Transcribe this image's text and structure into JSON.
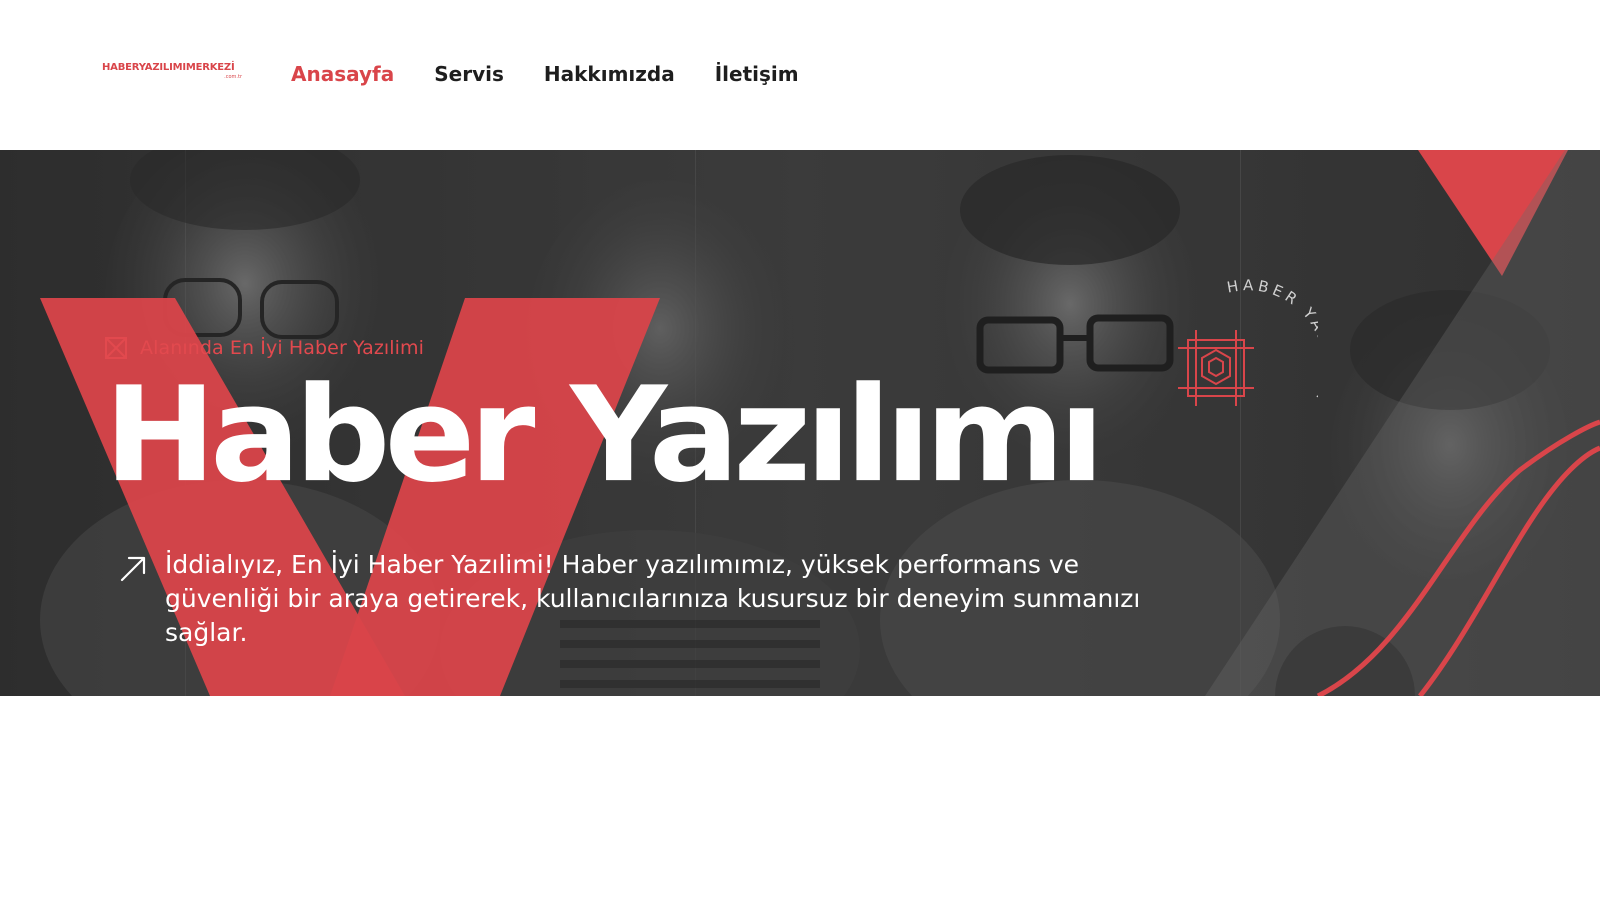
{
  "brand": {
    "logo_text": "HABERYAZILIMIMERKEZİ",
    "logo_sub": ".com.tr",
    "accent": "#d9454a"
  },
  "nav": {
    "items": [
      {
        "label": "Anasayfa",
        "active": true
      },
      {
        "label": "Servis",
        "active": false
      },
      {
        "label": "Hakkımızda",
        "active": false
      },
      {
        "label": "İletişim",
        "active": false
      }
    ]
  },
  "hero": {
    "tagline": "Alanında En İyi Haber Yazılimi",
    "title": "Haber Yazılımı",
    "description": "İddialıyız, En İyi Haber Yazılimi! Haber yazılımımız, yüksek performans ve güvenliği bir araya getirerek, kullanıcılarınıza kusursuz bir deneyim sunmanızı sağlar.",
    "badge_text": "HABER YAZILIMI",
    "icons": [
      "photo-icon",
      "arrow-up-right-icon",
      "hexagon-badge-icon"
    ]
  }
}
